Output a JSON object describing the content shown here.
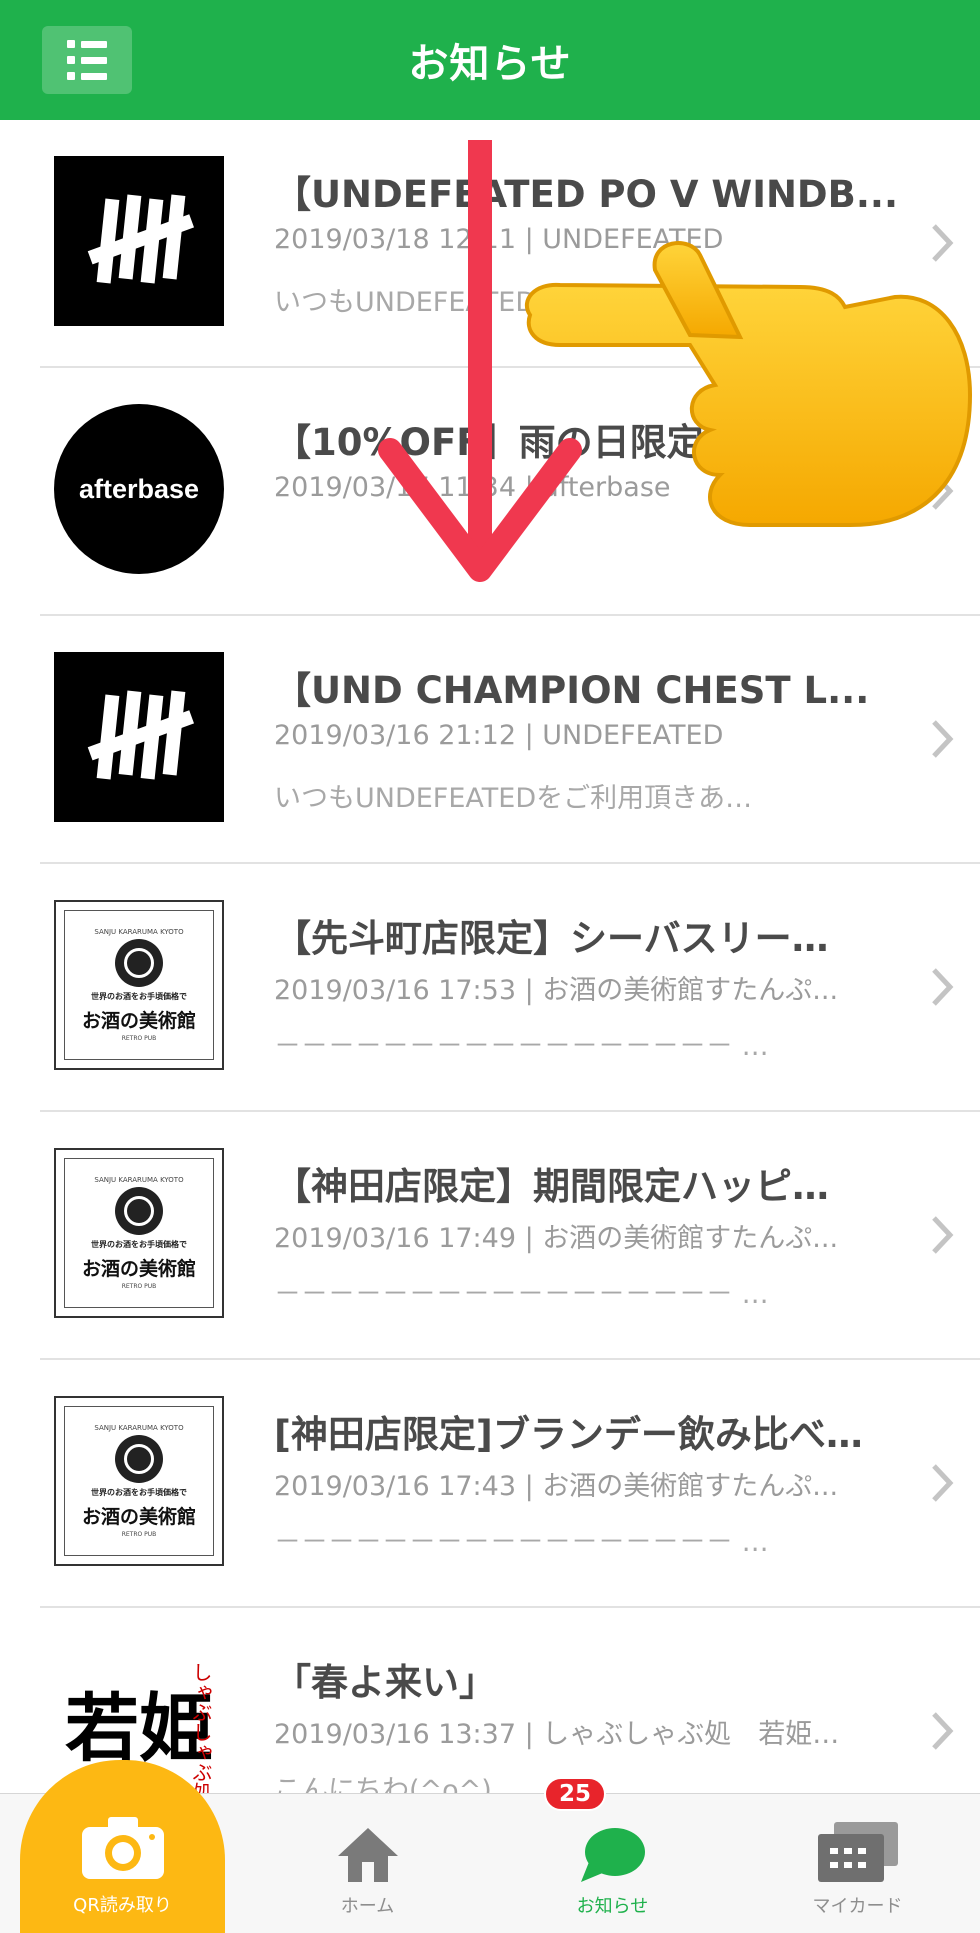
{
  "header": {
    "title": "お知らせ",
    "menu_icon": "list-menu-icon"
  },
  "notifications": [
    {
      "thumb": "undefeated-logo",
      "title": "【UNDEFEATED PO V WINDB...",
      "meta": "2019/03/18 12:11 | UNDEFEATED",
      "preview": "いつもUNDEFEATEDをご利用頂きあ…"
    },
    {
      "thumb": "afterbase-logo",
      "logo_text": "afterbase",
      "title": "【10%OFF】雨の日限定…",
      "meta": "2019/03/17 11:34 | afterbase",
      "preview": ""
    },
    {
      "thumb": "undefeated-logo",
      "title": "【UND CHAMPION CHEST L...",
      "meta": "2019/03/16 21:12 | UNDEFEATED",
      "preview": "いつもUNDEFEATEDをご利用頂きあ…"
    },
    {
      "thumb": "sake-museum-logo",
      "title": "【先斗町店限定】シーバスリー…",
      "meta": "2019/03/16 17:53 | お酒の美術館すたんぷ...",
      "preview": "－－－－－－－－－－－－－－－－－ …"
    },
    {
      "thumb": "sake-museum-logo",
      "title": "【神田店限定】期間限定ハッピ…",
      "meta": "2019/03/16 17:49 | お酒の美術館すたんぷ...",
      "preview": "－－－－－－－－－－－－－－－－－ …"
    },
    {
      "thumb": "sake-museum-logo",
      "title": "[神田店限定]ブランデー飲み比べ…",
      "meta": "2019/03/16 17:43 | お酒の美術館すたんぷ...",
      "preview": "－－－－－－－－－－－－－－－－－ …"
    },
    {
      "thumb": "wakahime-logo",
      "title": "「春よ来い」",
      "meta": "2019/03/16 13:37 | しゃぶしゃぶ処　若姫…",
      "preview": "こんにちわ(^o^)"
    }
  ],
  "sake_logo": {
    "top": "SANJU KARARUMA KYOTO",
    "sub": "世界のお酒をお手頃価格で",
    "name": "お酒の美術館",
    "foot": "RETRO PUB"
  },
  "wakahime_logo": {
    "main": "若姫",
    "side": "しゃぶしゃぶ処"
  },
  "tabbar": {
    "qr": {
      "label": "QR読み取り",
      "icon": "camera-icon"
    },
    "home": {
      "label": "ホーム",
      "icon": "home-icon"
    },
    "news": {
      "label": "お知らせ",
      "icon": "chat-bubble-icon",
      "badge": "25"
    },
    "card": {
      "label": "マイカード",
      "icon": "card-stack-icon"
    }
  },
  "colors": {
    "brand_green": "#1fb14c",
    "qr_yellow": "#fdb813",
    "badge_red": "#e8242b",
    "arrow_red": "#f0384f"
  }
}
